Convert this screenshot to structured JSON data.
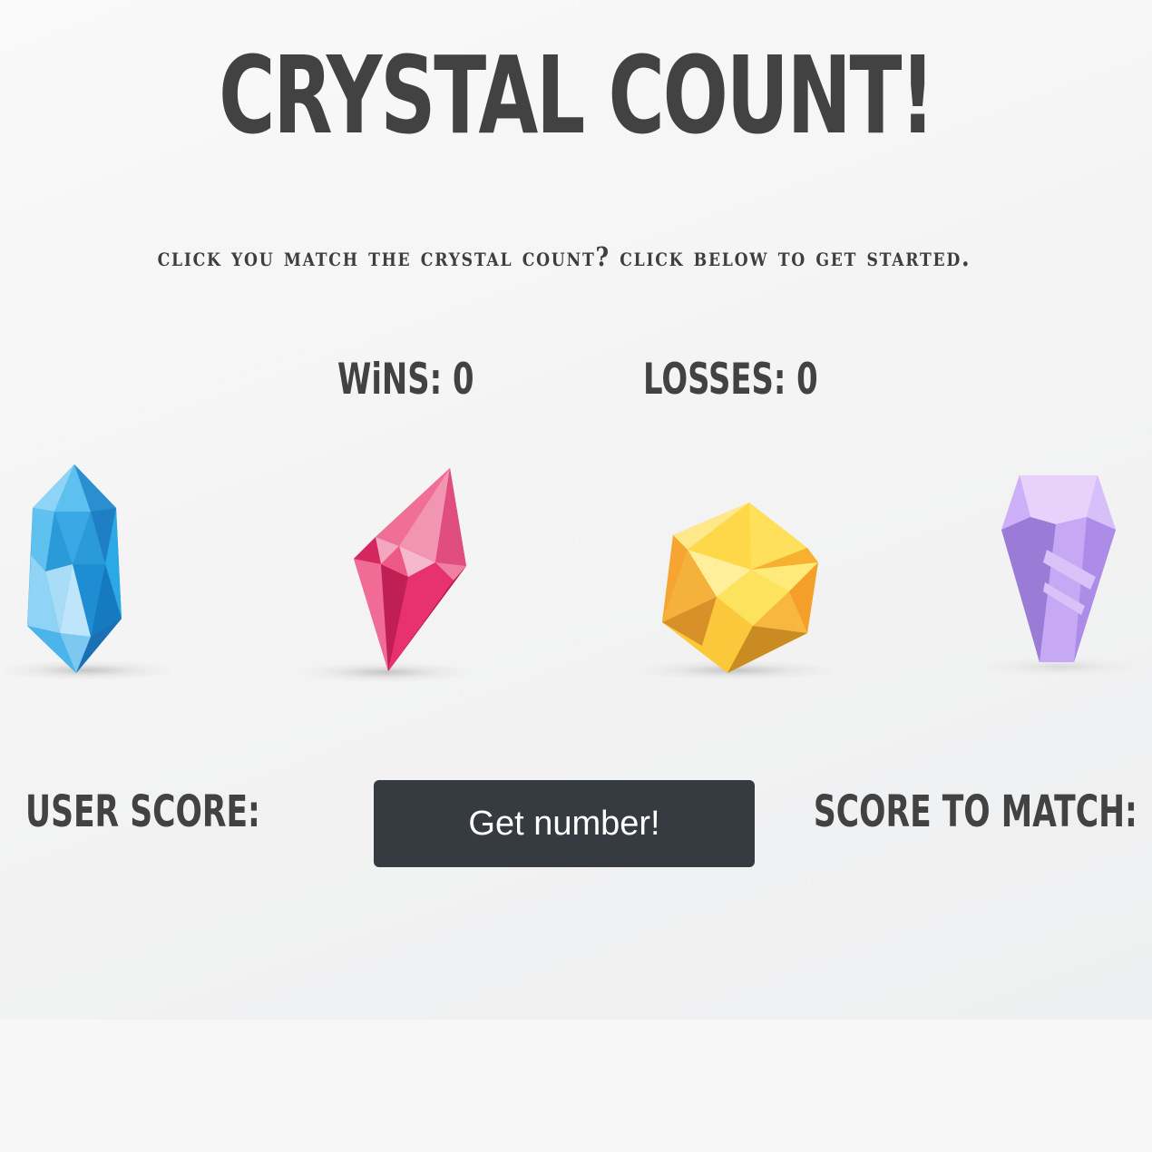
{
  "header": {
    "title": "CRYSTAL COUNT!",
    "subtitle": "Click you match the crystal count? Click below to get started."
  },
  "stats": {
    "wins_label": "WiNS:",
    "wins_value": "0",
    "losses_label": "LOSSES:",
    "losses_value": "0"
  },
  "crystals": [
    {
      "name": "blue-crystal",
      "color": "#2c9fdc"
    },
    {
      "name": "pink-crystal",
      "color": "#e8316f"
    },
    {
      "name": "yellow-crystal",
      "color": "#fcd23b"
    },
    {
      "name": "purple-crystal",
      "color": "#b99cf0"
    }
  ],
  "controls": {
    "user_score_label": "USER SCORE:",
    "user_score_value": "",
    "button_label": "Get number!",
    "score_to_match_label": "SCORE TO MATCH:",
    "score_to_match_value": ""
  },
  "colors": {
    "text": "#424242",
    "button_bg": "#363a41",
    "button_text": "#ffffff"
  }
}
